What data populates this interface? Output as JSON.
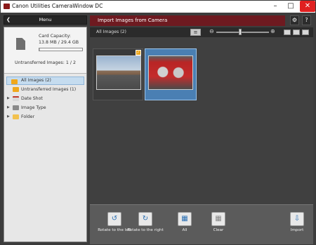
{
  "window": {
    "title": "Canon Utilities CameraWindow DC"
  },
  "sidebar": {
    "menu_label": "Menu",
    "card_capacity_label": "Card Capacity:",
    "card_capacity_value": "13.8 MB / 29.4 GB",
    "card_usage_fraction": 0.0005,
    "untransferred_label": "Untransferred Images: 1 / 2",
    "tree": [
      {
        "label": "All Images (2)",
        "icon": "all-images-icon",
        "selected": true
      },
      {
        "label": "Untransferred Images (1)",
        "icon": "untransferred-icon",
        "selected": false
      },
      {
        "label": "Date Shot",
        "icon": "calendar-icon",
        "selected": false
      },
      {
        "label": "Image Type",
        "icon": "image-type-icon",
        "selected": false
      },
      {
        "label": "Folder",
        "icon": "folder-icon",
        "selected": false
      }
    ]
  },
  "header": {
    "title": "Import Images from Camera"
  },
  "toolbar": {
    "label": "All Images (2)",
    "zoom_level": 0.45
  },
  "actions": {
    "rotate_left": "Rotate to the left",
    "rotate_right": "Rotate to the right",
    "all": "All",
    "clear": "Clear",
    "import": "Import"
  },
  "colors": {
    "header_bg": "#6e1a20",
    "selection": "#4a7fb3",
    "badge": "#f0a81c"
  }
}
